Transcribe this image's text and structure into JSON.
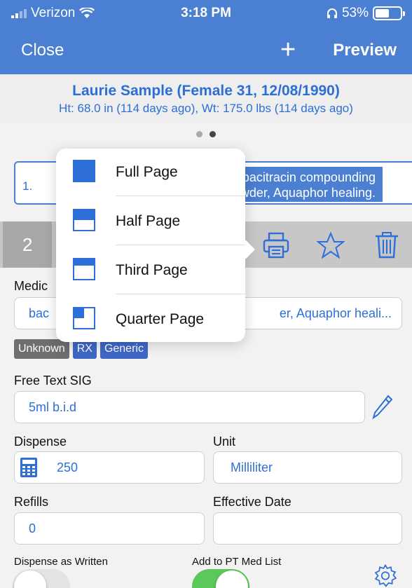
{
  "status_bar": {
    "carrier": "Verizon",
    "time": "3:18 PM",
    "battery": "53%"
  },
  "nav": {
    "close_label": "Close",
    "add_symbol": "+",
    "preview_label": "Preview"
  },
  "patient": {
    "name_line": "Laurie Sample (Female 31, 12/08/1990)",
    "vitals_line": "Ht: 68.0 in (114 days ago), Wt: 175.0 lbs (114 days ago)"
  },
  "med1": {
    "number": "1.",
    "line1": ", bacitracin compounding",
    "line2": "owder, Aquaphor healing."
  },
  "med2": {
    "number": "2",
    "medication_label": "Medic",
    "medication_value_left": "bac",
    "medication_value_right": "er, Aquaphor heali...",
    "tags": [
      {
        "text": "Unknown",
        "color": "#6e6e6e"
      },
      {
        "text": "RX",
        "color": "#3f67c6"
      },
      {
        "text": "Generic",
        "color": "#3f67c6"
      }
    ],
    "sig_label": "Free Text SIG",
    "sig_value": "5ml b.i.d",
    "dispense_label": "Dispense",
    "dispense_value": "250",
    "unit_label": "Unit",
    "unit_value": "Milliliter",
    "refills_label": "Refills",
    "refills_value": "0",
    "effective_date_label": "Effective Date",
    "effective_date_value": "",
    "daw_label": "Dispense as Written",
    "daw_on": false,
    "med_list_label": "Add to PT Med List",
    "med_list_on": true
  },
  "popover": {
    "items": [
      {
        "label": "Full Page",
        "icon": "full-page-icon"
      },
      {
        "label": "Half Page",
        "icon": "half-page-icon"
      },
      {
        "label": "Third Page",
        "icon": "third-page-icon"
      },
      {
        "label": "Quarter Page",
        "icon": "quarter-page-icon"
      }
    ]
  },
  "colors": {
    "accent": "#4a7fd1",
    "link": "#2d6fd6",
    "toggle_on": "#5ac85a"
  }
}
